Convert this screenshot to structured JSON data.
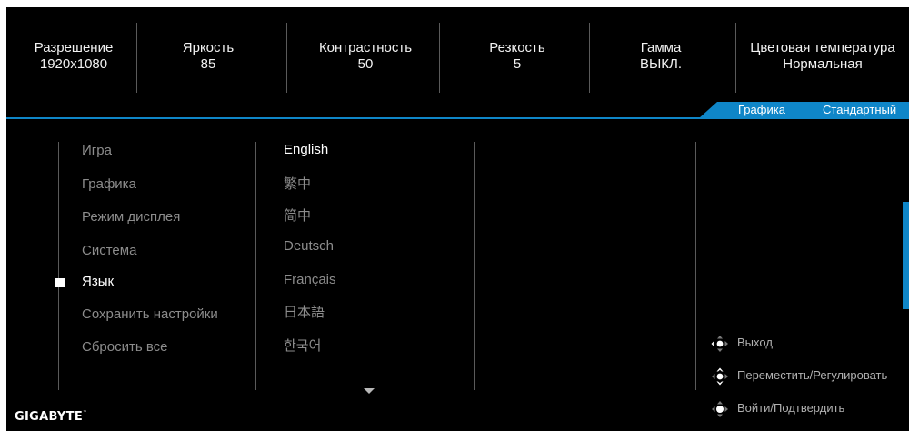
{
  "status": [
    {
      "label": "Разрешение",
      "value": "1920x1080"
    },
    {
      "label": "Яркость",
      "value": "85"
    },
    {
      "label": "Контрастность",
      "value": "50"
    },
    {
      "label": "Резкость",
      "value": "5"
    },
    {
      "label": "Гамма",
      "value": "ВЫКЛ."
    },
    {
      "label": "Цветовая температура",
      "value": "Нормальная"
    }
  ],
  "mode": {
    "category": "Графика",
    "preset": "Стандартный"
  },
  "menu": {
    "items": [
      "Игра",
      "Графика",
      "Режим дисплея",
      "Система",
      "Язык",
      "Сохранить настройки",
      "Сбросить все"
    ],
    "active_index": 4
  },
  "languages": {
    "items": [
      "English",
      "繁中",
      "简中",
      "Deutsch",
      "Français",
      "日本語",
      "한국어"
    ],
    "selected_index": 0
  },
  "help": {
    "exit": "Выход",
    "move_adjust": "Переместить/Регулировать",
    "enter_confirm": "Войти/Подтвердить"
  },
  "brand": {
    "logo_text": "GIGABYTE",
    "trademark": "™"
  },
  "colors": {
    "accent": "#0f86c8",
    "background": "#000000",
    "text": "#ffffff",
    "muted": "#8c8c8c"
  },
  "icons": {
    "joystick": "joystick-icon",
    "scroll_down": "chevron-down-icon"
  }
}
